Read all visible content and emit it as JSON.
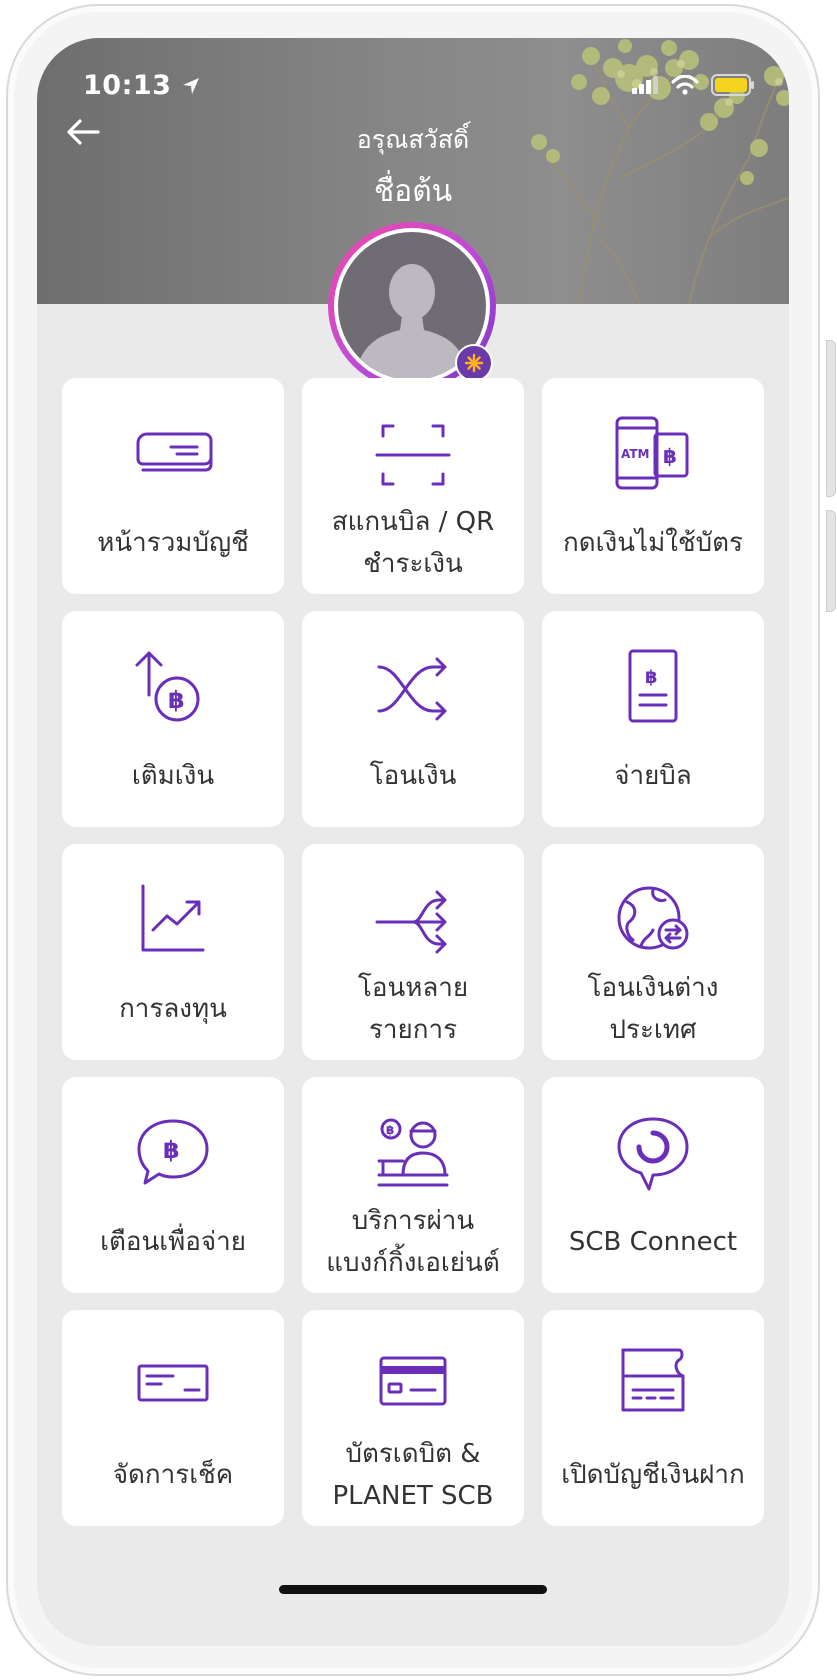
{
  "status_bar": {
    "time": "10:13"
  },
  "header": {
    "greeting": "อรุณสวัสดิ์",
    "name": "ชื่อต้น"
  },
  "colors": {
    "accent": "#6a2fb8",
    "tile_bg": "#ffffff",
    "screen_bg": "#eaeaea"
  },
  "menu": [
    {
      "label": "หน้ารวมบัญชี",
      "icon": "account-summary-icon"
    },
    {
      "label": "สแกนบิล / QR\nชำระเงิน",
      "icon": "scan-qr-icon"
    },
    {
      "label": "กดเงินไม่ใช้บัตร",
      "icon": "cardless-atm-icon"
    },
    {
      "label": "เติมเงิน",
      "icon": "top-up-icon"
    },
    {
      "label": "โอนเงิน",
      "icon": "transfer-icon"
    },
    {
      "label": "จ่ายบิล",
      "icon": "pay-bill-icon"
    },
    {
      "label": "การลงทุน",
      "icon": "investment-icon"
    },
    {
      "label": "โอนหลาย\nรายการ",
      "icon": "multi-transfer-icon"
    },
    {
      "label": "โอนเงินต่าง\nประเทศ",
      "icon": "international-transfer-icon"
    },
    {
      "label": "เตือนเพื่อจ่าย",
      "icon": "request-to-pay-icon"
    },
    {
      "label": "บริการผ่าน\nแบงก์กิ้งเอเย่นต์",
      "icon": "banking-agent-icon"
    },
    {
      "label": "SCB Connect",
      "icon": "scb-connect-icon"
    },
    {
      "label": "จัดการเช็ค",
      "icon": "cheque-icon"
    },
    {
      "label": "บัตรเดบิต &\nPLANET SCB",
      "icon": "debit-card-icon"
    },
    {
      "label": "เปิดบัญชีเงินฝาก",
      "icon": "open-account-icon"
    }
  ]
}
